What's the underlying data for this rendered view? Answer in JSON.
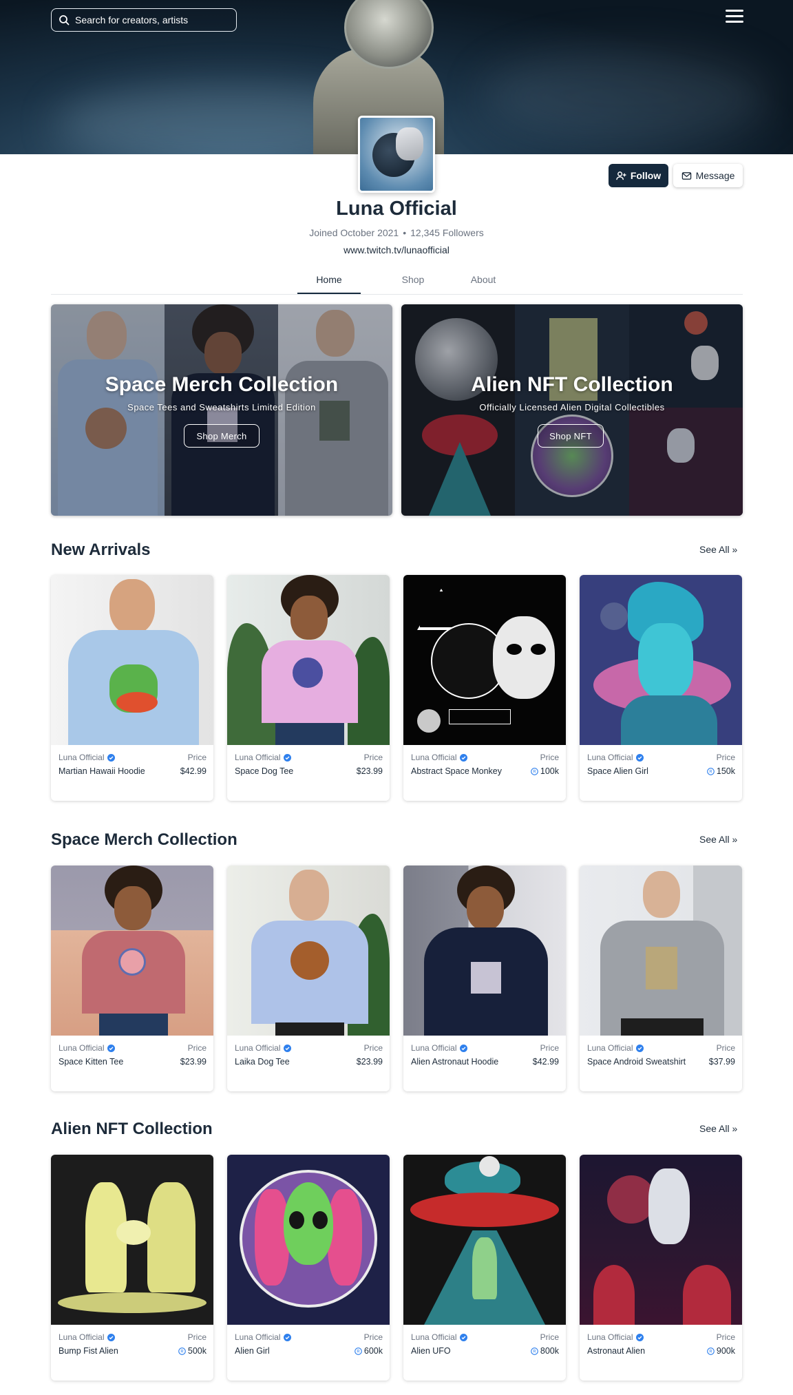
{
  "search": {
    "placeholder": "Search for creators, artists"
  },
  "profile": {
    "name": "Luna Official",
    "joined": "Joined October 2021",
    "followers": "12,345 Followers",
    "link": "www.twitch.tv/lunaofficial",
    "follow_label": "Follow",
    "message_label": "Message"
  },
  "tabs": [
    {
      "label": "Home",
      "active": true
    },
    {
      "label": "Shop",
      "active": false
    },
    {
      "label": "About",
      "active": false
    }
  ],
  "collections": [
    {
      "title": "Space Merch Collection",
      "subtitle": "Space Tees and Sweatshirts Limited Edition",
      "button": "Shop Merch"
    },
    {
      "title": "Alien NFT Collection",
      "subtitle": "Officially Licensed Alien Digital Collectibles",
      "button": "Shop NFT"
    }
  ],
  "price_label": "Price",
  "see_all": "See All",
  "sections": [
    {
      "title": "New Arrivals",
      "items": [
        {
          "creator": "Luna Official",
          "name": "Martian Hawaii Hoodie",
          "price": "$42.99",
          "token": false
        },
        {
          "creator": "Luna Official",
          "name": "Space Dog Tee",
          "price": "$23.99",
          "token": false
        },
        {
          "creator": "Luna Official",
          "name": "Abstract Space Monkey",
          "price": "100k",
          "token": true
        },
        {
          "creator": "Luna Official",
          "name": "Space Alien Girl",
          "price": "150k",
          "token": true
        }
      ]
    },
    {
      "title": "Space Merch Collection",
      "items": [
        {
          "creator": "Luna Official",
          "name": "Space Kitten Tee",
          "price": "$23.99",
          "token": false
        },
        {
          "creator": "Luna Official",
          "name": "Laika Dog Tee",
          "price": "$23.99",
          "token": false
        },
        {
          "creator": "Luna Official",
          "name": "Alien Astronaut Hoodie",
          "price": "$42.99",
          "token": false
        },
        {
          "creator": "Luna Official",
          "name": "Space Android Sweatshirt",
          "price": "$37.99",
          "token": false
        }
      ]
    },
    {
      "title": "Alien NFT Collection",
      "items": [
        {
          "creator": "Luna Official",
          "name": "Bump Fist Alien",
          "price": "500k",
          "token": true
        },
        {
          "creator": "Luna Official",
          "name": "Alien Girl",
          "price": "600k",
          "token": true
        },
        {
          "creator": "Luna Official",
          "name": "Alien UFO",
          "price": "800k",
          "token": true
        },
        {
          "creator": "Luna Official",
          "name": "Astronaut Alien",
          "price": "900k",
          "token": true
        }
      ]
    }
  ],
  "colors": {
    "primary": "#15293d",
    "verified": "#2f80ed",
    "text": "#1d2b3a",
    "muted": "#6b7380"
  }
}
